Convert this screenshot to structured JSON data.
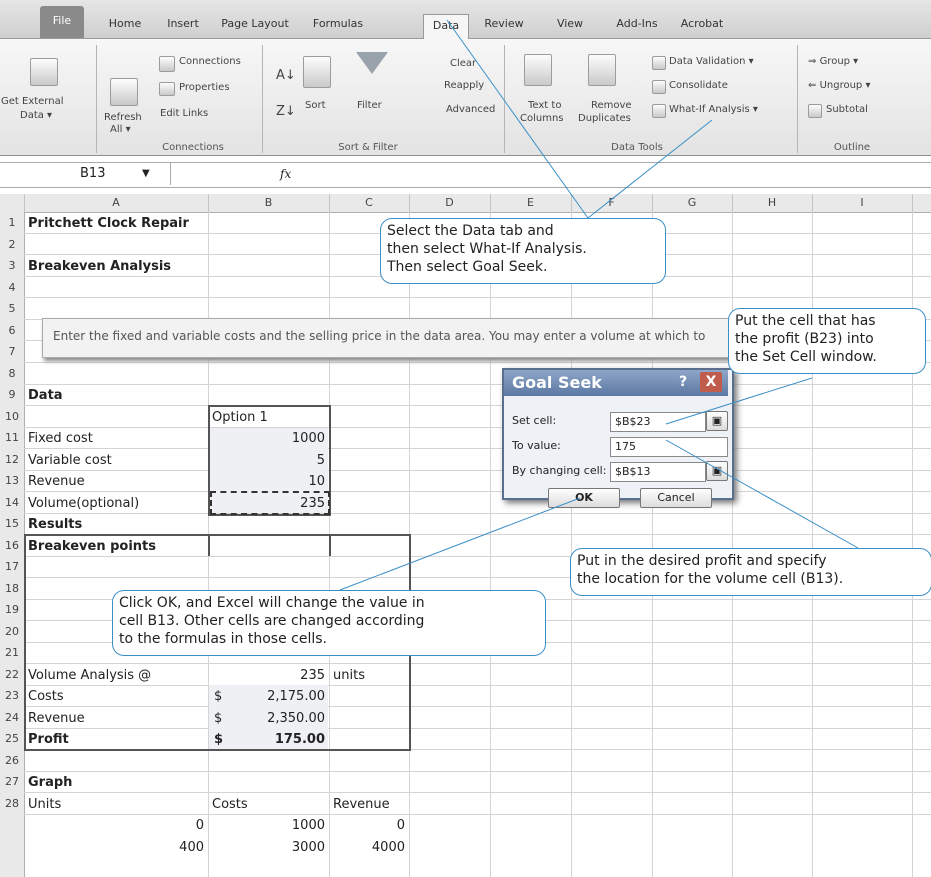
{
  "tabs": [
    "File",
    "Home",
    "Insert",
    "Page Layout",
    "Formulas",
    "Data",
    "Review",
    "View",
    "Add-Ins",
    "Acrobat"
  ],
  "active_tab": "Data",
  "ribbon": {
    "get_external_1": "Get External",
    "get_external_2": "Data ▾",
    "refresh_1": "Refresh",
    "refresh_2": "All ▾",
    "connections": "Connections",
    "properties": "Properties",
    "edit_links": "Edit Links",
    "group_connections": "Connections",
    "sort": "Sort",
    "filter": "Filter",
    "clear": "Clear",
    "reapply": "Reapply",
    "advanced": "Advanced",
    "group_sort_filter": "Sort & Filter",
    "text_to_1": "Text to",
    "text_to_2": "Columns",
    "remove_1": "Remove",
    "remove_2": "Duplicates",
    "data_validation": "Data Validation ▾",
    "consolidate": "Consolidate",
    "what_if": "What-If Analysis ▾",
    "group_data_tools": "Data Tools",
    "group": "Group ▾",
    "ungroup": "Ungroup ▾",
    "subtotal": "Subtotal",
    "group_outline": "Outline"
  },
  "formula_bar": {
    "name_box": "B13",
    "fx": "fx"
  },
  "columns": [
    "A",
    "B",
    "C",
    "D",
    "E",
    "F",
    "G",
    "H",
    "I"
  ],
  "rows": [
    "1",
    "2",
    "3",
    "4",
    "5",
    "6",
    "7",
    "8",
    "9",
    "10",
    "11",
    "12",
    "13",
    "14",
    "15",
    "16",
    "17",
    "18",
    "19",
    "20",
    "21",
    "22",
    "23",
    "24",
    "25",
    "26",
    "27",
    "28"
  ],
  "sheet": {
    "a1": "Pritchett Clock Repair",
    "a3": "Breakeven Analysis",
    "note": "Enter the fixed and variable costs and the selling price in the data area. You may enter a volume at which to",
    "a8": "Data",
    "b9": "Option 1",
    "a10": "Fixed cost",
    "b10": "1000",
    "a11": "Variable cost",
    "b11": "5",
    "a12": "Revenue",
    "b12": "10",
    "a13": "Volume(optional)",
    "b13": "235",
    "a15": "Results",
    "a16": "Breakeven points",
    "a20": "Volume Analysis @",
    "b20": "235",
    "c20": "units",
    "a21": "Costs",
    "b21_sym": "$",
    "b21": "2,175.00",
    "a22": "Revenue",
    "b22_sym": "$",
    "b22": "2,350.00",
    "a23": "Profit",
    "b23_sym": "$",
    "b23": "175.00",
    "a25": "Graph",
    "a26": "Units",
    "b26": "Costs",
    "c26": "Revenue",
    "a27": "0",
    "b27": "1000",
    "c27": "0",
    "a28": "400",
    "b28": "3000",
    "c28": "4000"
  },
  "dialog": {
    "title": "Goal Seek",
    "help": "?",
    "close": "X",
    "set_cell_label": "Set cell:",
    "set_cell_value": "$B$23",
    "to_value_label": "To value:",
    "to_value_value": "175",
    "changing_label": "By changing cell:",
    "changing_value": "$B$13",
    "ok": "OK",
    "cancel": "Cancel"
  },
  "callouts": {
    "data_tab_1": "Select the Data tab and",
    "data_tab_2": "then select What-If Analysis.",
    "data_tab_3": "Then select Goal Seek.",
    "set_cell_1": "Put the cell that has",
    "set_cell_2": "the profit (B23) into",
    "set_cell_3": "the Set Cell window.",
    "profit_1": "Put in the desired profit and specify",
    "profit_2": "the location for the volume cell (B13).",
    "ok_1": "Click OK, and Excel will change the value in",
    "ok_2": "cell B13. Other cells are changed according",
    "ok_3": "to the formulas in those cells."
  }
}
